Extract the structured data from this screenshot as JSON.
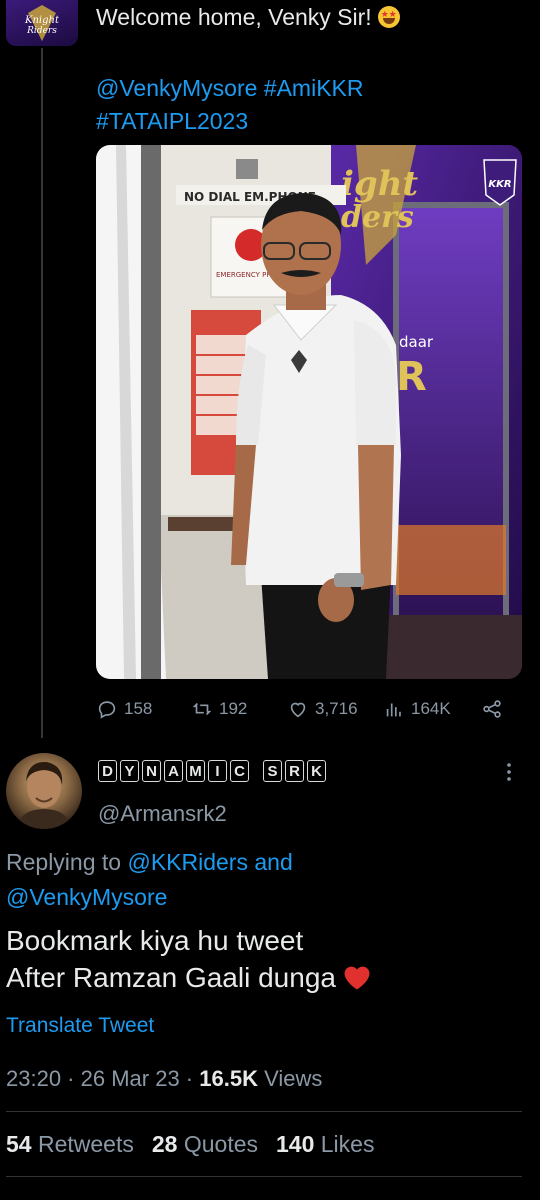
{
  "tweet": {
    "text": "Welcome home, Venky Sir!",
    "hashtags_line1": "@VenkyMysore #AmiKKR",
    "hashtags_line2": "#TATAIPL2023",
    "photo_signs": {
      "no_dial": "NO DIAL EM.PHONE",
      "emergency": "EMERGENCY PHONE",
      "kkr_badge": "KKR",
      "daar": "daar"
    },
    "actions": {
      "replies": "158",
      "retweets": "192",
      "likes": "3,716",
      "views": "164K"
    }
  },
  "reply": {
    "display_name_letters": [
      "D",
      "Y",
      "N",
      "A",
      "M",
      "I",
      "C",
      "",
      "S",
      "R",
      "K"
    ],
    "handle": "@Armansrk2",
    "replying_prefix": "Replying to",
    "replying_to_1": "@KKRiders",
    "replying_and": "and",
    "replying_to_2": "@VenkyMysore",
    "line1": "Bookmark kiya hu tweet",
    "line2": "After Ramzan Gaali dunga",
    "translate": "Translate Tweet",
    "time": "23:20",
    "date": "26 Mar 23",
    "views_count": "16.5K",
    "views_label": "Views",
    "retweets_count": "54",
    "retweets_label": "Retweets",
    "quotes_count": "28",
    "quotes_label": "Quotes",
    "likes_count": "140",
    "likes_label": "Likes"
  },
  "colors": {
    "background": "#000000",
    "link": "#1d9bf0",
    "muted": "#8b98a5",
    "text": "#e7e9ea"
  }
}
